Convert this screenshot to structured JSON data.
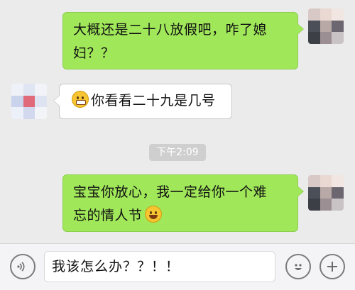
{
  "messages": [
    {
      "side": "right",
      "text_line1": "大概还是二十八放假吧，咋了媳",
      "text_line2": "妇？？"
    },
    {
      "side": "left",
      "emoji": "grimace-emoji",
      "text": "你看看二十九是几号"
    },
    {
      "side": "right",
      "text_line1": "宝宝你放心，我一定给你一个难",
      "text_line2": "忘的情人节",
      "emoji": "smile-emoji"
    }
  ],
  "timestamp": "下午2:09",
  "input": {
    "value": "我该怎么办？？！！"
  },
  "icons": {
    "voice": "voice-icon",
    "emoji": "emoji-icon",
    "plus": "plus-icon"
  },
  "colors": {
    "right_bubble": "#a0e75a",
    "left_bubble": "#ffffff",
    "background": "#ebebeb"
  }
}
